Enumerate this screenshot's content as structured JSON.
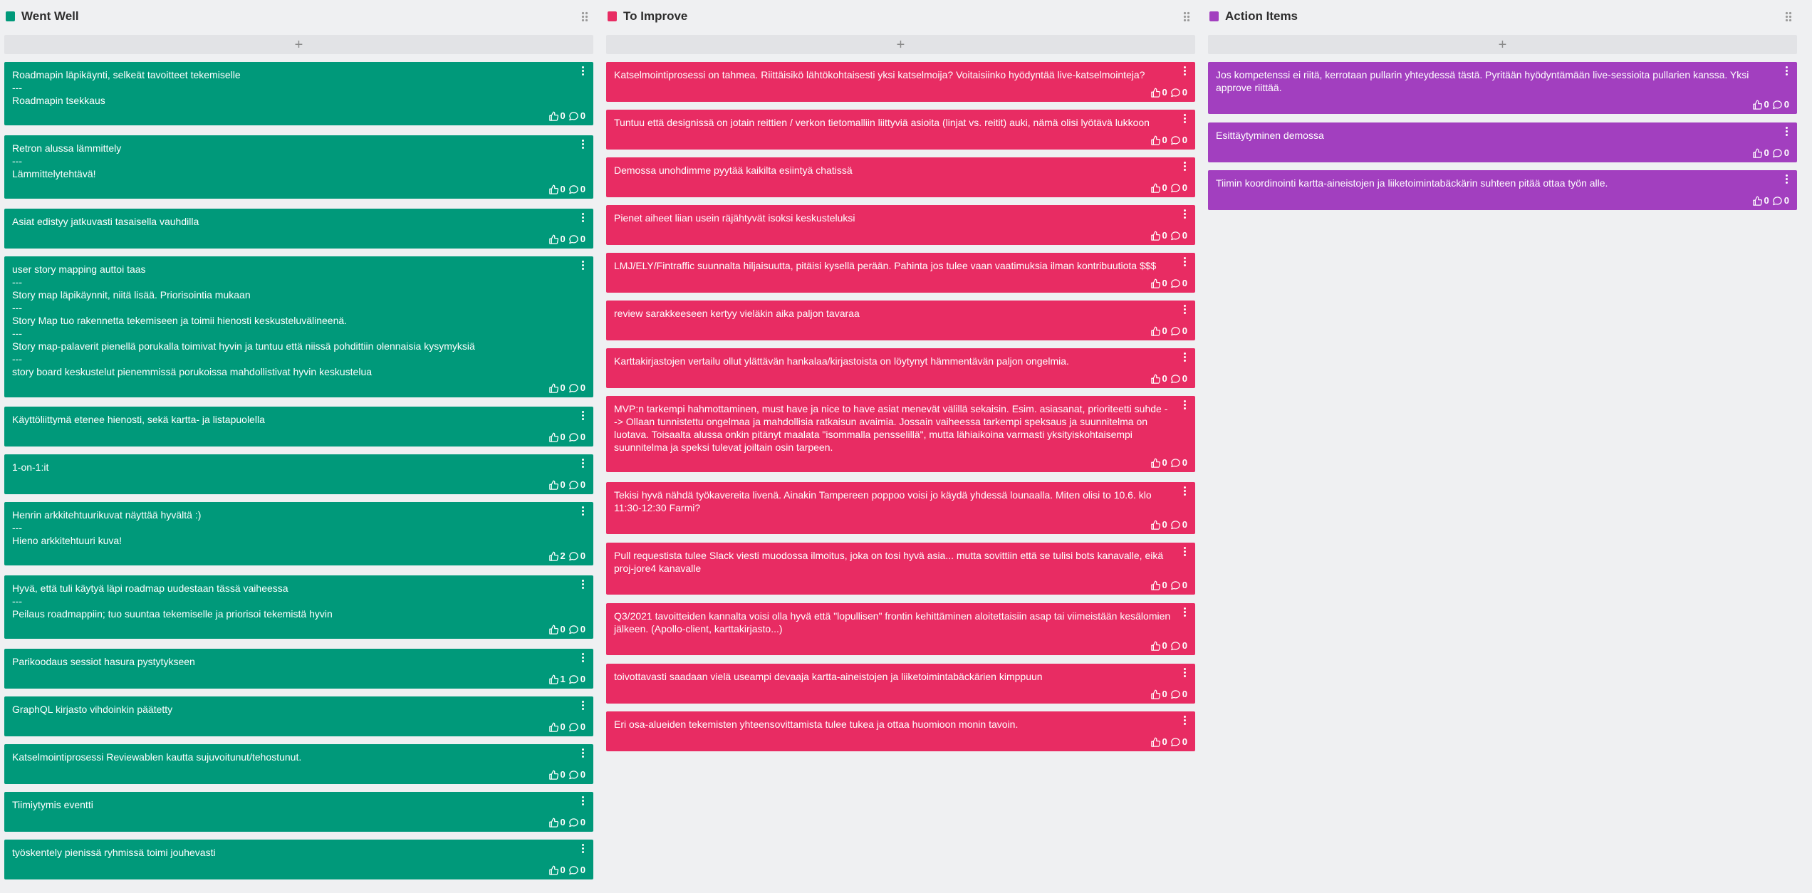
{
  "columns": [
    {
      "title": "Went Well",
      "color": "#00997a",
      "add_label": "+",
      "cards": [
        {
          "text": "Roadmapin läpikäynti, selkeät tavoitteet tekemiselle\n---\nRoadmapin tsekkaus",
          "likes": "0",
          "comments": "0"
        },
        {
          "text": "Retron alussa lämmittely\n---\nLämmittelytehtävä!",
          "likes": "0",
          "comments": "0"
        },
        {
          "text": "Asiat edistyy jatkuvasti tasaisella vauhdilla",
          "likes": "0",
          "comments": "0"
        },
        {
          "text": "user story mapping auttoi taas\n---\nStory map läpikäynnit, niitä lisää. Priorisointia mukaan\n---\nStory Map tuo rakennetta tekemiseen ja toimii hienosti keskusteluvälineenä.\n---\nStory map-palaverit pienellä porukalla toimivat hyvin ja tuntuu että niissä pohdittiin olennaisia kysymyksiä\n---\nstory board keskustelut pienemmissä porukoissa mahdollistivat hyvin keskustelua",
          "likes": "0",
          "comments": "0"
        },
        {
          "text": "Käyttöliittymä etenee hienosti, sekä kartta- ja listapuolella",
          "likes": "0",
          "comments": "0"
        },
        {
          "text": "1-on-1:it",
          "likes": "0",
          "comments": "0"
        },
        {
          "text": "Henrin arkkitehtuurikuvat näyttää hyvältä :)\n---\nHieno arkkitehtuuri kuva!",
          "likes": "2",
          "comments": "0"
        },
        {
          "text": "Hyvä, että tuli käytyä läpi roadmap uudestaan tässä vaiheessa\n---\nPeilaus roadmappiin; tuo suuntaa tekemiselle ja priorisoi tekemistä hyvin",
          "likes": "0",
          "comments": "0"
        },
        {
          "text": "Parikoodaus sessiot hasura pystytykseen",
          "likes": "1",
          "comments": "0"
        },
        {
          "text": "GraphQL kirjasto vihdoinkin päätetty",
          "likes": "0",
          "comments": "0"
        },
        {
          "text": "Katselmointiprosessi Reviewablen kautta sujuvoitunut/tehostunut.",
          "likes": "0",
          "comments": "0"
        },
        {
          "text": "Tiimiytymis eventti",
          "likes": "0",
          "comments": "0"
        },
        {
          "text": "työskentely pienissä ryhmissä toimi jouhevasti",
          "likes": "0",
          "comments": "0"
        }
      ]
    },
    {
      "title": "To Improve",
      "color": "#e82c63",
      "add_label": "+",
      "cards": [
        {
          "text": "Katselmointiprosessi on tahmea. Riittäisikö lähtökohtaisesti yksi katselmoija? Voitaisiinko hyödyntää live-katselmointeja?",
          "likes": "0",
          "comments": "0"
        },
        {
          "text": "Tuntuu että designissä on jotain reittien / verkon tietomalliin liittyviä asioita (linjat vs. reitit) auki, nämä olisi lyötävä lukkoon",
          "likes": "0",
          "comments": "0"
        },
        {
          "text": "Demossa unohdimme pyytää kaikilta esiintyä chatissä",
          "likes": "0",
          "comments": "0"
        },
        {
          "text": "Pienet aiheet liian usein räjähtyvät isoksi keskusteluksi",
          "likes": "0",
          "comments": "0"
        },
        {
          "text": "LMJ/ELY/Fintraffic suunnalta hiljaisuutta, pitäisi kysellä perään. Pahinta jos tulee vaan vaatimuksia ilman kontribuutiota $$$",
          "likes": "0",
          "comments": "0"
        },
        {
          "text": "review sarakkeeseen kertyy vieläkin aika paljon tavaraa",
          "likes": "0",
          "comments": "0"
        },
        {
          "text": "Karttakirjastojen vertailu ollut ylättävän hankalaa/kirjastoista on löytynyt hämmentävän paljon ongelmia.",
          "likes": "0",
          "comments": "0"
        },
        {
          "text": "MVP:n tarkempi hahmottaminen, must have ja nice to have asiat menevät välillä sekaisin. Esim. asiasanat, prioriteetti suhde --> Ollaan tunnistettu ongelmaa ja mahdollisia ratkaisun avaimia. Jossain vaiheessa tarkempi speksaus ja suunnitelma on luotava. Toisaalta alussa onkin pitänyt maalata \"isommalla pensselillä\", mutta lähiaikoina varmasti yksityiskohtaisempi suunnitelma ja speksi tulevat joiltain osin tarpeen.",
          "likes": "0",
          "comments": "0"
        },
        {
          "text": "Tekisi hyvä nähdä työkavereita livenä. Ainakin Tampereen poppoo voisi jo käydä yhdessä lounaalla. Miten olisi to 10.6. klo 11:30-12:30 Farmi?",
          "likes": "0",
          "comments": "0"
        },
        {
          "text": "Pull requestista tulee Slack viesti muodossa ilmoitus, joka on tosi hyvä asia... mutta sovittiin että se tulisi bots kanavalle, eikä proj-jore4 kanavalle",
          "likes": "0",
          "comments": "0"
        },
        {
          "text": "Q3/2021 tavoitteiden kannalta voisi olla hyvä että \"lopullisen\" frontin kehittäminen aloitettaisiin asap tai viimeistään kesälomien jälkeen. (Apollo-client, karttakirjasto...)",
          "likes": "0",
          "comments": "0"
        },
        {
          "text": "toivottavasti saadaan vielä useampi devaaja kartta-aineistojen ja liiketoimintabäckärien kimppuun",
          "likes": "0",
          "comments": "0"
        },
        {
          "text": "Eri osa-alueiden tekemisten yhteensovittamista tulee tukea ja ottaa huomioon monin tavoin.",
          "likes": "0",
          "comments": "0"
        }
      ]
    },
    {
      "title": "Action Items",
      "color": "#a23fbf",
      "add_label": "+",
      "cards": [
        {
          "text": "Jos kompetenssi ei riitä, kerrotaan pullarin yhteydessä tästä. Pyritään hyödyntämään live-sessioita pullarien kanssa. Yksi approve riittää.",
          "likes": "0",
          "comments": "0"
        },
        {
          "text": "Esittäytyminen demossa",
          "likes": "0",
          "comments": "0"
        },
        {
          "text": "Tiimin koordinointi kartta-aineistojen ja liiketoimintabäckärin suhteen pitää ottaa työn alle.",
          "likes": "0",
          "comments": "0"
        }
      ]
    }
  ]
}
